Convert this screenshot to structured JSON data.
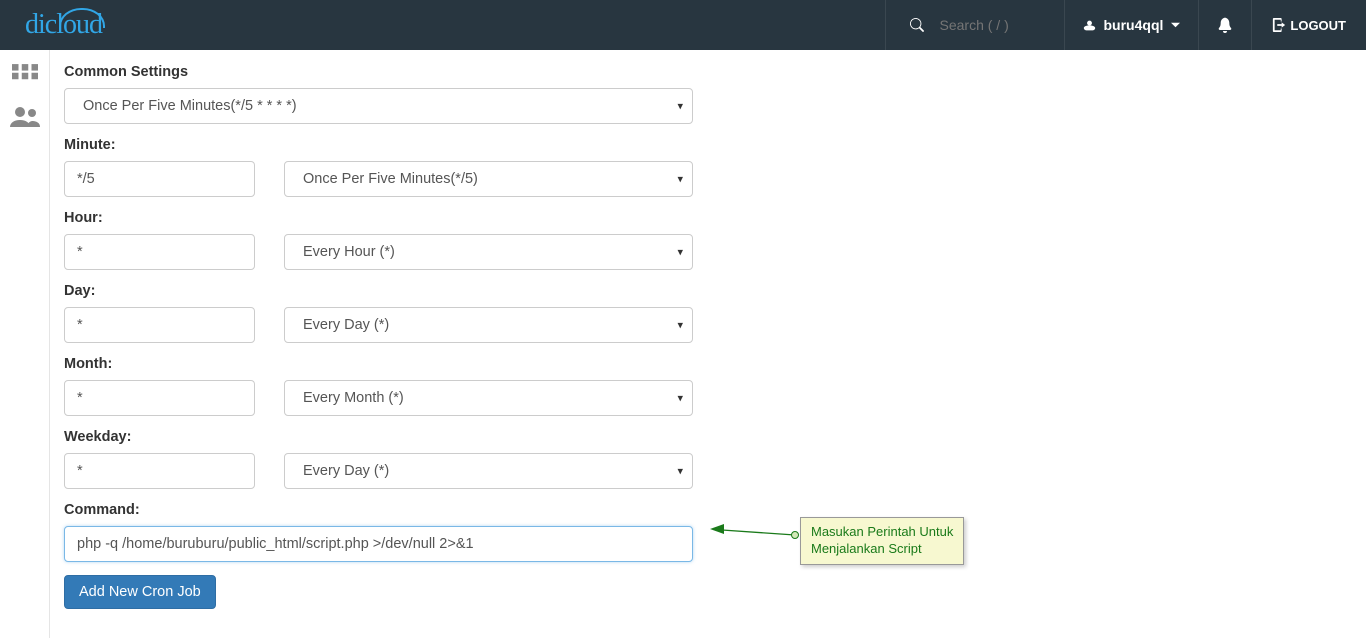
{
  "header": {
    "search_placeholder": "Search ( / )",
    "username": "buru4qql",
    "logout_label": "LOGOUT"
  },
  "form": {
    "common_settings_label": "Common Settings",
    "common_settings_value": "Once Per Five Minutes(*/5 * * * *)",
    "minute_label": "Minute:",
    "minute_value": "*/5",
    "minute_select": "Once Per Five Minutes(*/5)",
    "hour_label": "Hour:",
    "hour_value": "*",
    "hour_select": "Every Hour (*)",
    "day_label": "Day:",
    "day_value": "*",
    "day_select": "Every Day (*)",
    "month_label": "Month:",
    "month_value": "*",
    "month_select": "Every Month (*)",
    "weekday_label": "Weekday:",
    "weekday_value": "*",
    "weekday_select": "Every Day (*)",
    "command_label": "Command:",
    "command_value": "php -q /home/buruburu/public_html/script.php >/dev/null 2>&1",
    "submit_label": "Add New Cron Job"
  },
  "annotation": {
    "line1": "Masukan Perintah Untuk",
    "line2": "Menjalankan Script"
  }
}
